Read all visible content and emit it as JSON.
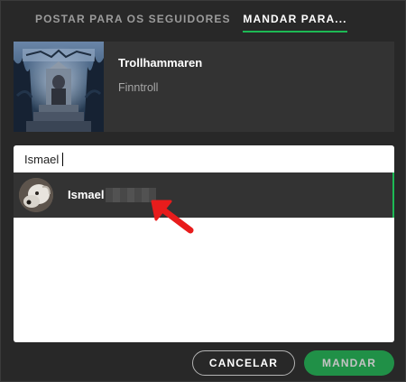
{
  "tabs": [
    {
      "label": "POSTAR PARA OS SEGUIDORES",
      "active": false
    },
    {
      "label": "MANDAR PARA...",
      "active": true
    }
  ],
  "album": {
    "title": "Trollhammaren",
    "artist": "Finntroll"
  },
  "search": {
    "value": "Ismael",
    "placeholder": ""
  },
  "results": [
    {
      "name": "Ismael",
      "selected": true
    }
  ],
  "buttons": {
    "cancel_label": "CANCELAR",
    "send_label": "MANDAR"
  },
  "colors": {
    "accent": "#1db954",
    "background": "#282828",
    "card": "#333333",
    "arrow": "#e81c1c"
  }
}
